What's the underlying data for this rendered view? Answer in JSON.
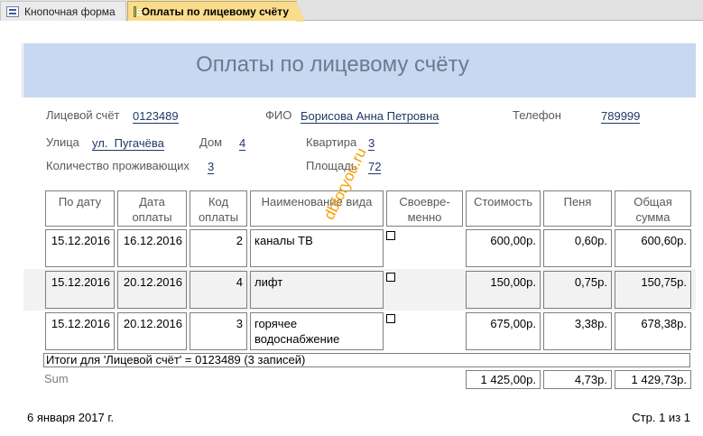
{
  "tabs": [
    {
      "label": "Кнопочная форма",
      "icon": "form-icon",
      "active": false
    },
    {
      "label": "Оплаты по лицевому счёту",
      "icon": "report-icon",
      "active": true
    }
  ],
  "report": {
    "title": "Оплаты по лицевому счёту",
    "fields": {
      "account_label": "Лицевой счёт",
      "account_value": "0123489",
      "name_label": "ФИО",
      "name_value": "Борисова Анна Петровна",
      "phone_label": "Телефон",
      "phone_value": "789999",
      "street_label": "Улица",
      "street_value": "ул.  Пугачёва",
      "house_label": "Дом",
      "house_value": "4",
      "apartment_label": "Квартира",
      "apartment_value": "3",
      "residents_label": "Количество проживающих",
      "residents_value": "3",
      "area_label": "Площадь",
      "area_value": "72"
    },
    "columns": [
      "По дату",
      "Дата оплаты",
      "Код оплаты",
      "Наименование вида",
      "Своевре-менно",
      "Стоимость",
      "Пеня",
      "Общая сумма"
    ],
    "rows": [
      {
        "by_date": "15.12.2016",
        "pay_date": "16.12.2016",
        "code": "2",
        "name": "каналы ТВ",
        "on_time": false,
        "cost": "600,00р.",
        "penalty": "0,60р.",
        "total": "600,60р."
      },
      {
        "by_date": "15.12.2016",
        "pay_date": "20.12.2016",
        "code": "4",
        "name": "лифт",
        "on_time": false,
        "cost": "150,00р.",
        "penalty": "0,75р.",
        "total": "150,75р."
      },
      {
        "by_date": "15.12.2016",
        "pay_date": "20.12.2016",
        "code": "3",
        "name": "горячее водоснабжение",
        "on_time": false,
        "cost": "675,00р.",
        "penalty": "3,38р.",
        "total": "678,38р."
      }
    ],
    "totals_caption": "Итоги для 'Лицевой счёт' =  0123489 (3 записей)",
    "sum_label": "Sum",
    "sum": {
      "cost": "1 425,00р.",
      "penalty": "4,73р.",
      "total": "1 429,73р."
    },
    "watermark": "dbforyou.ru",
    "footer_date": "6 января 2017 г.",
    "footer_page": "Стр. 1 из 1"
  }
}
